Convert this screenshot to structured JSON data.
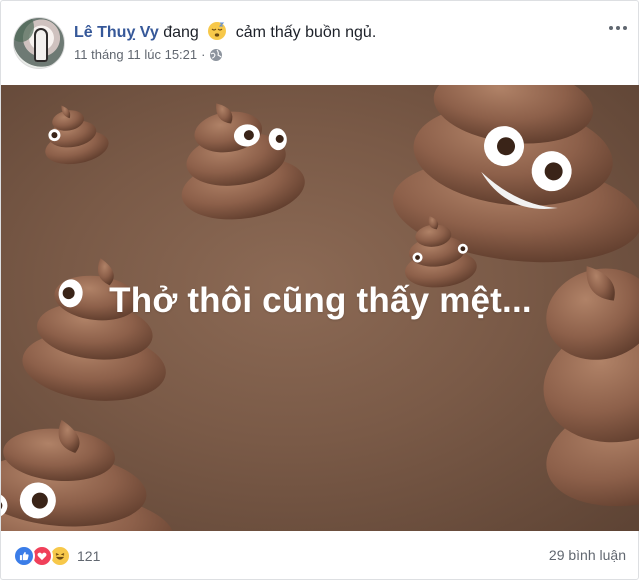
{
  "post": {
    "author": "Lê Thuỵ Vy",
    "feeling_prefix": "đang",
    "feeling_text": "cảm thấy buồn ngủ.",
    "feeling_icon": "sleepy-face-icon",
    "timestamp": "11 tháng 11 lúc 15:21",
    "privacy_icon": "globe-icon",
    "more_icon": "more-options-icon",
    "image_text": "Thở thôi cũng thấy mệt...",
    "reaction_icons": [
      "like-icon",
      "love-icon",
      "haha-icon"
    ],
    "reaction_count": "121",
    "comment_count": "29 bình luận"
  },
  "colors": {
    "author_link": "#365899",
    "background_brown": "#7a5a47",
    "like_blue": "#3b7de8",
    "love_red": "#f0405a",
    "haha_yellow": "#f7c84a"
  }
}
